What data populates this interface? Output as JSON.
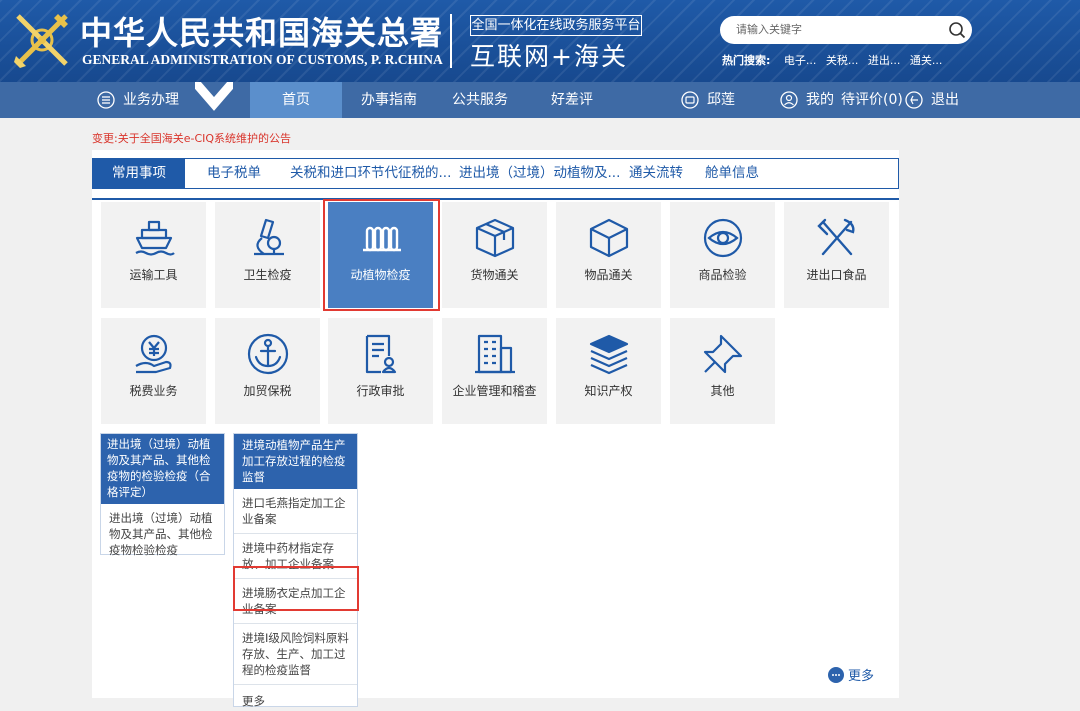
{
  "header": {
    "org_cn": "中华人民共和国海关总署",
    "org_en": "GENERAL ADMINISTRATION OF CUSTOMS, P. R.CHINA",
    "platform_tag": "全国一体化在线政务服务平台",
    "platform_name": "互联网+海关",
    "search_placeholder": "请输入关键字",
    "hot_label": "热门搜索:",
    "hot_items": [
      "电子...",
      "关税...",
      "进出...",
      "通关..."
    ]
  },
  "nav": {
    "business": "业务办理",
    "home": "首页",
    "guide": "办事指南",
    "public": "公共服务",
    "rating": "好差评",
    "user": "邱莲",
    "mine": "我的",
    "pending": "待评价(0)",
    "logout": "退出"
  },
  "notice": "变更:关于全国海关e-CIQ系统维护的公告",
  "tabs": [
    "常用事项",
    "电子税单",
    "关税和进口环节代征税的...",
    "进出境（过境）动植物及...",
    "通关流转",
    "舱单信息"
  ],
  "tiles": [
    {
      "label": "运输工具",
      "icon": "ship-icon"
    },
    {
      "label": "卫生检疫",
      "icon": "microscope-icon"
    },
    {
      "label": "动植物检疫",
      "icon": "plant-icon"
    },
    {
      "label": "货物通关",
      "icon": "package-icon"
    },
    {
      "label": "物品通关",
      "icon": "cube-icon"
    },
    {
      "label": "商品检验",
      "icon": "eye-icon"
    },
    {
      "label": "进出口食品",
      "icon": "cutlery-icon"
    },
    {
      "label": "税费业务",
      "icon": "yuan-hand-icon"
    },
    {
      "label": "加贸保税",
      "icon": "anchor-icon"
    },
    {
      "label": "行政审批",
      "icon": "document-icon"
    },
    {
      "label": "企业管理和稽查",
      "icon": "building-icon"
    },
    {
      "label": "知识产权",
      "icon": "book-stack-icon"
    },
    {
      "label": "其他",
      "icon": "pin-icon"
    }
  ],
  "sub_left": {
    "head": "进出境（过境）动植物及其产品、其他检疫物的检验检疫（合格评定）",
    "items": [
      "进出境（过境）动植物及其产品、其他检疫物检验检疫"
    ]
  },
  "sub_right": {
    "head": "进境动植物产品生产加工存放过程的检疫监督",
    "items": [
      "进口毛燕指定加工企业备案",
      "进境中药材指定存放、加工企业备案",
      "进境肠衣定点加工企业备案",
      "进境Ⅰ级风险饲料原料存放、生产、加工过程的检疫监督",
      "更多"
    ]
  },
  "more": "更多",
  "colors": {
    "brand": "#1f5aa8",
    "nav": "#3e6aa5",
    "highlight": "#e23a32",
    "selected_tile": "#4a7fc2"
  }
}
